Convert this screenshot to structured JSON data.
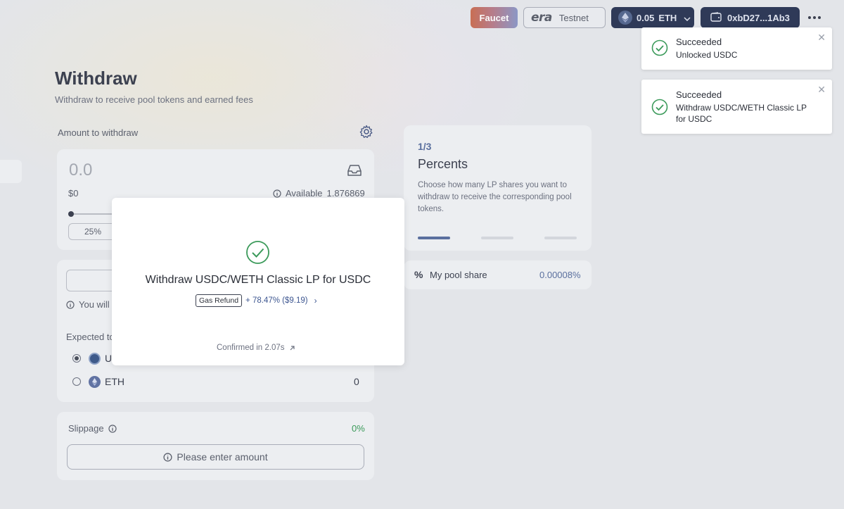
{
  "topbar": {
    "faucet_label": "Faucet",
    "network_logo": "era",
    "network_label": "Testnet",
    "balance_amount": "0.05",
    "balance_token": "ETH",
    "account_label": "0xbD27...1Ab3"
  },
  "toasts": [
    {
      "title": "Succeeded",
      "message": "Unlocked USDC"
    },
    {
      "title": "Succeeded",
      "message": "Withdraw USDC/WETH Classic LP for USDC"
    }
  ],
  "page": {
    "title": "Withdraw",
    "subtitle": "Withdraw to receive pool tokens and earned fees"
  },
  "form": {
    "amount_label": "Amount to withdraw",
    "amount_value": "0.0",
    "usd_value": "$0",
    "available_label": "Available",
    "available_value": "1.876869",
    "percent_button": "25%",
    "you_will_prefix": "You will",
    "expected_prefix": "Expected to",
    "tokens": [
      {
        "symbol": "U",
        "amount": ""
      },
      {
        "symbol": "ETH",
        "amount": "0"
      }
    ],
    "slippage_label": "Slippage",
    "slippage_value": "0%",
    "submit_label": "Please enter amount"
  },
  "info": {
    "step": "1/3",
    "title": "Percents",
    "text": "Choose how many LP shares you want to withdraw to receive the corresponding pool tokens.",
    "pool_share_label": "My pool share",
    "pool_share_value": "0.00008%"
  },
  "modal": {
    "title": "Withdraw USDC/WETH Classic LP for USDC",
    "gas_tag": "Gas Refund",
    "gas_value": "+ 78.47% ($9.19)",
    "gas_arrow": "›",
    "confirmed": "Confirmed in 2.07s"
  },
  "colors": {
    "accent": "#2f3a58",
    "success": "#3b9a5a",
    "link": "#5a6f9e"
  },
  "icons": [
    "gear-icon",
    "wallet-icon",
    "info-icon",
    "check-circle-icon",
    "close-icon",
    "chevron-down-icon",
    "more-icon",
    "percent-icon",
    "external-link-icon"
  ]
}
